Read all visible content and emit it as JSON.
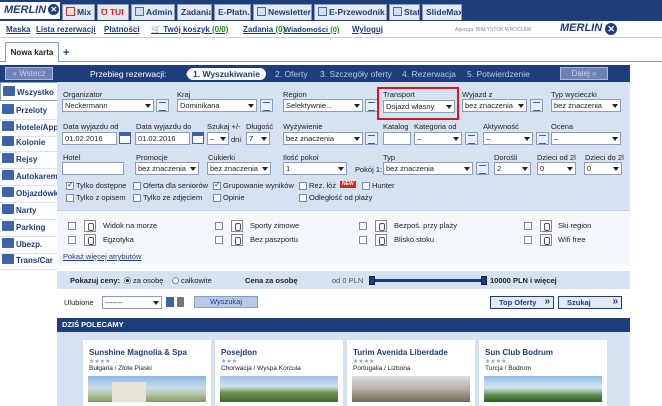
{
  "brand": {
    "name": "MERLIN",
    "x": "✕"
  },
  "top_tabs": [
    {
      "label": "Mix",
      "icon": "mix-icon"
    },
    {
      "label": "TUI",
      "icon": "tui-logo-icon"
    },
    {
      "label": "Admin",
      "icon": "person-icon"
    },
    {
      "label": "Zadania",
      "icon": "tasks-icon"
    },
    {
      "label": "E-Płatn.",
      "icon": "payment-icon"
    },
    {
      "label": "Newsletter",
      "icon": "envelope-icon"
    },
    {
      "label": "E-Przewodnik",
      "icon": "guide-icon"
    },
    {
      "label": "Stat",
      "icon": "chart-icon"
    },
    {
      "label": "SlideMax",
      "icon": "slides-icon"
    }
  ],
  "menu": {
    "maska": "Maska",
    "lista": "Lista rezerwacji",
    "platnosci": "Płatności",
    "koszyk": "Twój koszyk",
    "koszyk_count": "(0/0)",
    "zadania": "Zadania",
    "zadania_count": "(0)",
    "wiadomosci": "Wiadomości",
    "wiadomosci_count": "(0)",
    "wyloguj": "Wyloguj",
    "agency": "Agencja: BIAŁYSTOK WROCŁAW"
  },
  "tabs": {
    "current": "Nowa karta",
    "add": "+"
  },
  "sidebar": [
    {
      "label": "Wszystko"
    },
    {
      "label": "Przeloty"
    },
    {
      "label": "Hotele/App"
    },
    {
      "label": "Kolonie"
    },
    {
      "label": "Rejsy"
    },
    {
      "label": "Autokarem"
    },
    {
      "label": "Objazdówk"
    },
    {
      "label": "Narty"
    },
    {
      "label": "Parking"
    },
    {
      "label": "Ubezp."
    },
    {
      "label": "Trans/Car"
    }
  ],
  "progress": {
    "back": "Wstecz",
    "next": "Dalej",
    "label": "Przebieg rezerwacji:",
    "steps": [
      "1. Wyszukiwanie",
      "2. Oferty",
      "3. Szczegóły oferty",
      "4. Rezerwacja",
      "5. Potwierdzenie"
    ]
  },
  "form": {
    "organizator": {
      "label": "Organizator",
      "value": "Neckermann"
    },
    "kraj": {
      "label": "Kraj",
      "value": "Dominikana"
    },
    "region": {
      "label": "Region",
      "value": "Selektywnie..."
    },
    "transport": {
      "label": "Transport",
      "value": "Dojazd własny"
    },
    "wyjazd_z": {
      "label": "Wyjazd z",
      "value": "bez znaczenia"
    },
    "typ_wycieczki": {
      "label": "Typ wycieczki",
      "value": "bez znaczenia"
    },
    "data_od": {
      "label": "Data wyjazdu od",
      "value": "01.02.2016"
    },
    "data_do": {
      "label": "Data wyjazdu do",
      "value": "01.02.2016"
    },
    "szukaj": {
      "label": "Szukaj +/-",
      "value": "–",
      "unit": "dni"
    },
    "dlugosc": {
      "label": "Długość",
      "value": "7"
    },
    "wyzywienie": {
      "label": "Wyżywienie",
      "value": "bez znaczenia"
    },
    "katalog": {
      "label": "Katalog",
      "value": ""
    },
    "kategoria": {
      "label": "Kategoria od",
      "value": "–"
    },
    "aktywnosc": {
      "label": "Aktywność",
      "value": "–"
    },
    "ocena": {
      "label": "Ocena",
      "value": "–"
    },
    "hotel": {
      "label": "Hotel",
      "value": ""
    },
    "promocje": {
      "label": "Promocje",
      "value": "bez znaczenia"
    },
    "cukierki": {
      "label": "Cukierki",
      "value": "bez znaczenia"
    },
    "ilosc_pokoi": {
      "label": "Ilość pokoi",
      "value": "1"
    },
    "pokoj": {
      "label": "Pokój 1:",
      "typ_label": "Typ",
      "value": "bez znaczenia"
    },
    "dorosli": {
      "label": "Dorośli",
      "value": "2"
    },
    "dzieci1": {
      "label": "Dzieci od 2l",
      "value": "0"
    },
    "dzieci2": {
      "label": "Dzieci do 2l",
      "value": "0"
    },
    "checks": [
      {
        "label": "Tylko dostępne",
        "on": true
      },
      {
        "label": "Oferta dla seniorów",
        "on": false
      },
      {
        "label": "Grupowanie wyników",
        "on": true
      },
      {
        "label": "Rez. łóż",
        "on": false
      },
      {
        "label": "Hunter",
        "on": false
      },
      {
        "label": "Tylko z opisem",
        "on": false
      },
      {
        "label": "Tylko ze zdjęciem",
        "on": false
      },
      {
        "label": "Opinie",
        "on": false
      },
      {
        "label": "Odległość od plaży",
        "on": false
      }
    ],
    "new_badge": "NEW"
  },
  "attributes": [
    {
      "label": "Widok na morze"
    },
    {
      "label": "Sporty zimowe"
    },
    {
      "label": "Bezpoś. przy plaży"
    },
    {
      "label": "Ski region"
    },
    {
      "label": "Egzotyka"
    },
    {
      "label": "Bez paszportu"
    },
    {
      "label": "Blisko stoku"
    },
    {
      "label": "Wifi free"
    }
  ],
  "more_attrs": "Pokaż więcej atrybutów",
  "price": {
    "label": "Pokazuj ceny:",
    "per_person": "za osobę",
    "total": "całkowite",
    "cena_label": "Cena za osobę",
    "from": "od 0 PLN",
    "to": "10000 PLN i więcej",
    "range_low_pct": 0,
    "range_high_pct": 100
  },
  "fav": {
    "label": "Ulubione",
    "value": "-------",
    "search_btn": "Wyszukaj"
  },
  "buttons": {
    "top_offers": "Top Oferty",
    "search": "Szukaj"
  },
  "recommend": {
    "title": "DZIŚ POLECAMY",
    "cards": [
      {
        "title": "Sunshine Magnolia & Spa",
        "stars": "★★★★",
        "location": "Bułgaria / Złote Piaski"
      },
      {
        "title": "Posejdon",
        "stars": "★★★",
        "location": "Chorwacja / Wyspa Korcula"
      },
      {
        "title": "Turim Avenida Liberdade",
        "stars": "★★★★",
        "location": "Portugalia / Lizbona"
      },
      {
        "title": "Sun Club Bodrum",
        "stars": "★★★★",
        "location": "Turcja / Bodrum"
      }
    ]
  },
  "colors": {
    "navy": "#1d3d7c",
    "panel": "#d6e2f2",
    "highlight": "#d81818"
  }
}
